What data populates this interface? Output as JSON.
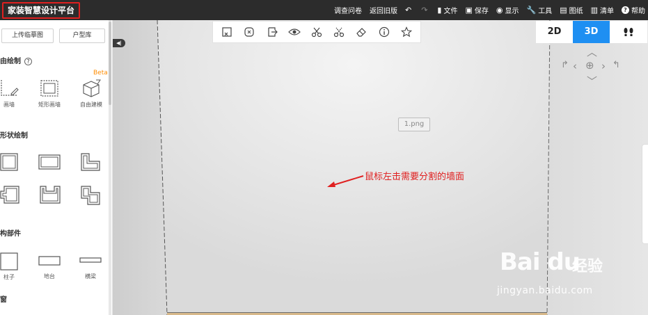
{
  "app": {
    "title": "家装智慧设计平台"
  },
  "topmenu": [
    {
      "label": "调查问卷",
      "icon": ""
    },
    {
      "label": "返回旧版",
      "icon": ""
    },
    {
      "label": "",
      "icon": "↶"
    },
    {
      "label": "",
      "icon": "↷"
    },
    {
      "label": "文件",
      "icon": "▮"
    },
    {
      "label": "保存",
      "icon": "▣"
    },
    {
      "label": "显示",
      "icon": "◉"
    },
    {
      "label": "工具",
      "icon": "🔧"
    },
    {
      "label": "图纸",
      "icon": "▤"
    },
    {
      "label": "清单",
      "icon": "▥"
    },
    {
      "label": "帮助",
      "icon": "?"
    }
  ],
  "sidebar": {
    "upload_label": "上传临摹图",
    "layouts_label": "户型库",
    "section_draw": "由绘制",
    "beta": "Beta",
    "draw_tools": [
      "画墙",
      "矩形画墙",
      "自由建模"
    ],
    "section_shapes": "形状绘制",
    "section_parts": "构部件",
    "parts": [
      "柱子",
      "地台",
      "横梁"
    ],
    "section_window": "窗"
  },
  "view": {
    "mode_2d": "2D",
    "mode_3d": "3D",
    "mode_walk": "ꟾꟾ",
    "active": "3D"
  },
  "toolbar_icons": [
    "box-select",
    "replace",
    "export-wall",
    "eye",
    "scissors",
    "split",
    "eraser",
    "info",
    "star"
  ],
  "canvas": {
    "image_label": "1.png",
    "annotation": "鼠标左击需要分割的墙面"
  },
  "watermark": {
    "brand": "Bai du",
    "sub": "经验",
    "url": "jingyan.baidu.com"
  },
  "colors": {
    "accent": "#1e8ff2",
    "highlight": "#e02020",
    "beta": "#ff8c00",
    "topbar": "#2c2c2c"
  }
}
